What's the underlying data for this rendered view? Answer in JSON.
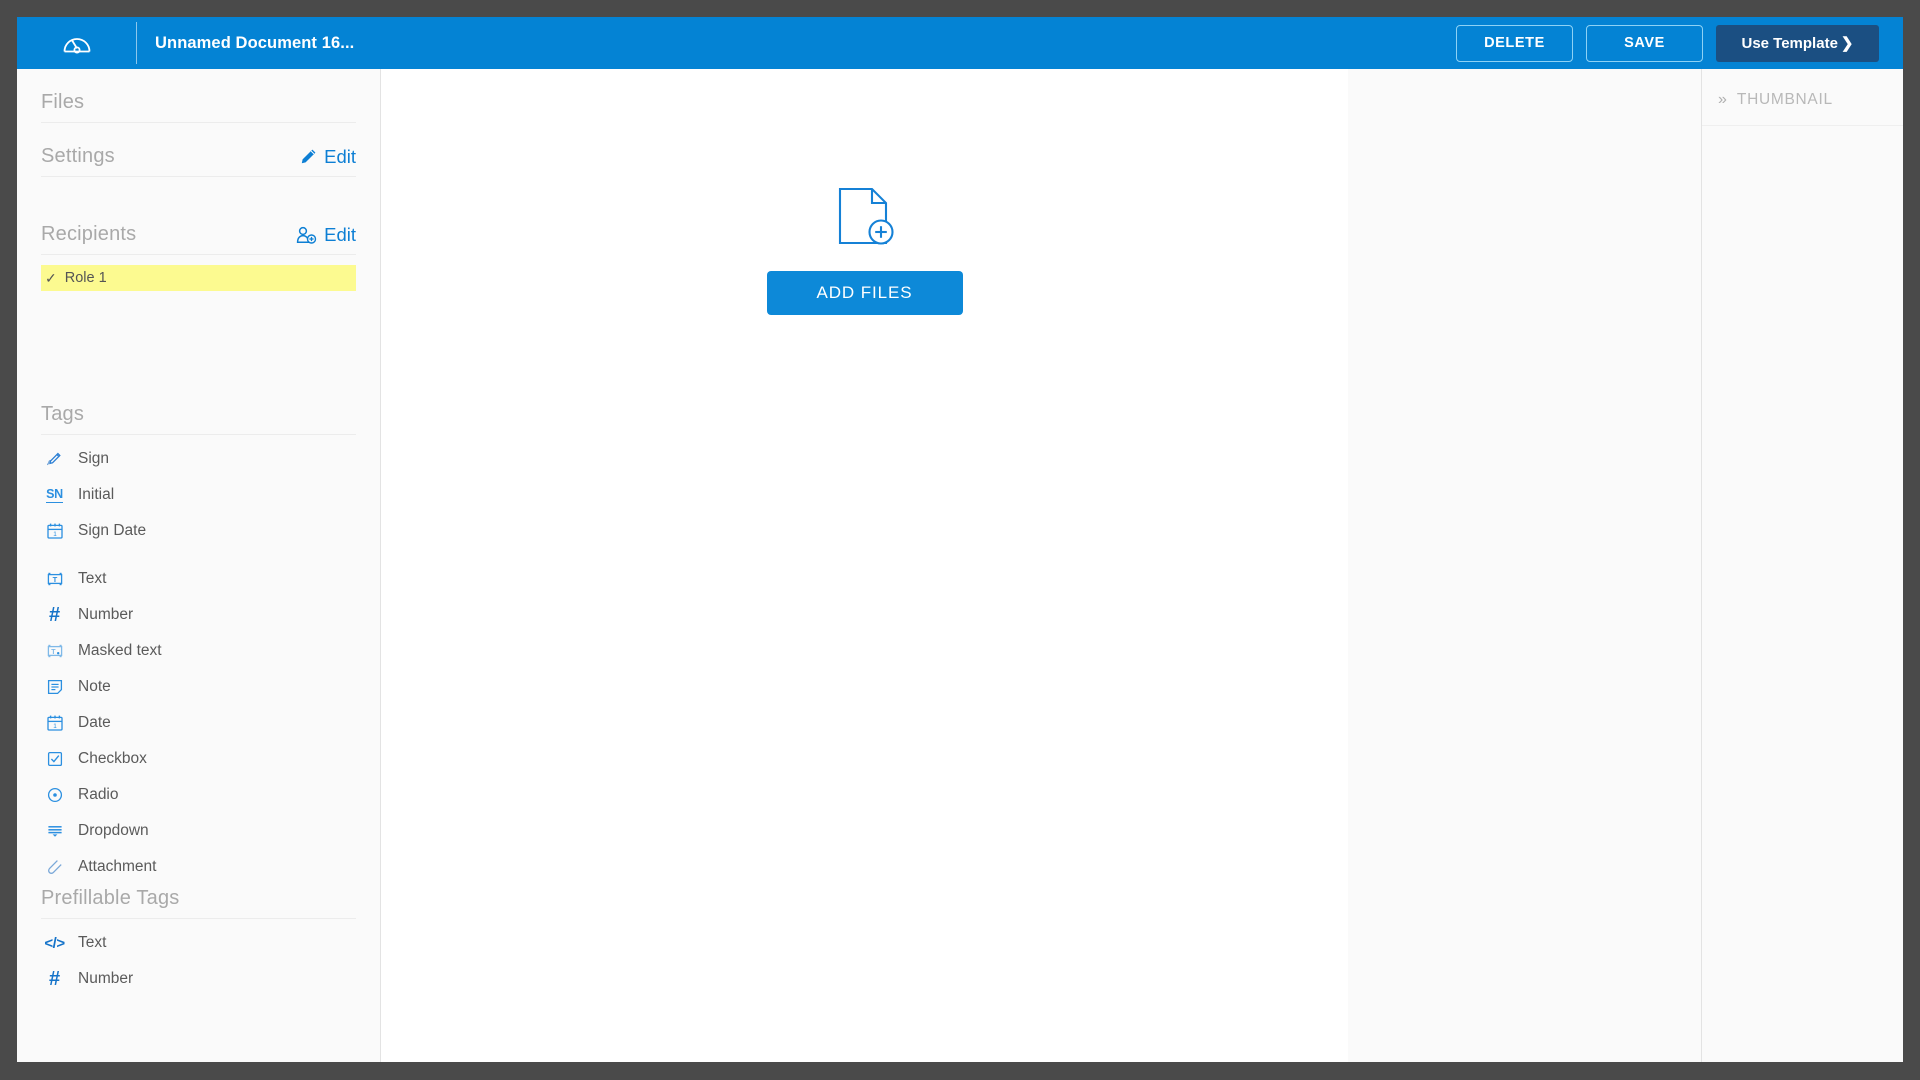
{
  "header": {
    "logo_icon": "gauge-icon",
    "document_title": "Unnamed Document 16...",
    "delete_label": "DELETE",
    "save_label": "SAVE",
    "use_template_label": "Use Template",
    "use_template_chevron": "❯",
    "background_color": "#0483d4",
    "use_template_color": "#1b4f82"
  },
  "sidebar": {
    "files": {
      "title": "Files"
    },
    "settings": {
      "title": "Settings",
      "edit_label": "Edit",
      "edit_icon": "pencil-icon"
    },
    "recipients": {
      "title": "Recipients",
      "edit_label": "Edit",
      "edit_icon": "person-add-icon",
      "roles": [
        {
          "check": "✓",
          "label": "Role 1",
          "highlight_color": "#fcfa90"
        }
      ]
    },
    "tags": {
      "title": "Tags",
      "group_one": [
        {
          "icon": "sign-pen-icon",
          "label": "Sign"
        },
        {
          "icon": "initial-sn-icon",
          "label": "Initial"
        },
        {
          "icon": "calendar-icon",
          "label": "Sign Date"
        }
      ],
      "group_two": [
        {
          "icon": "text-field-icon",
          "label": "Text"
        },
        {
          "icon": "hash-number-icon",
          "label": "Number"
        },
        {
          "icon": "masked-text-icon",
          "label": "Masked text"
        },
        {
          "icon": "note-icon",
          "label": "Note"
        },
        {
          "icon": "calendar-icon",
          "label": "Date"
        },
        {
          "icon": "checkbox-icon",
          "label": "Checkbox"
        },
        {
          "icon": "radio-icon",
          "label": "Radio"
        },
        {
          "icon": "dropdown-icon",
          "label": "Dropdown"
        },
        {
          "icon": "paperclip-icon",
          "label": "Attachment"
        }
      ]
    },
    "prefillable_tags": {
      "title": "Prefillable Tags",
      "items": [
        {
          "icon": "code-brackets-icon",
          "label": "Text"
        },
        {
          "icon": "hash-number-icon",
          "label": "Number"
        }
      ]
    }
  },
  "canvas": {
    "dropzone_icon": "document-add-icon",
    "add_files_label": "ADD FILES",
    "add_files_color": "#0d89d8"
  },
  "thumbnail_panel": {
    "collapse_icon": "double-chevron-right-icon",
    "title": "THUMBNAIL"
  }
}
